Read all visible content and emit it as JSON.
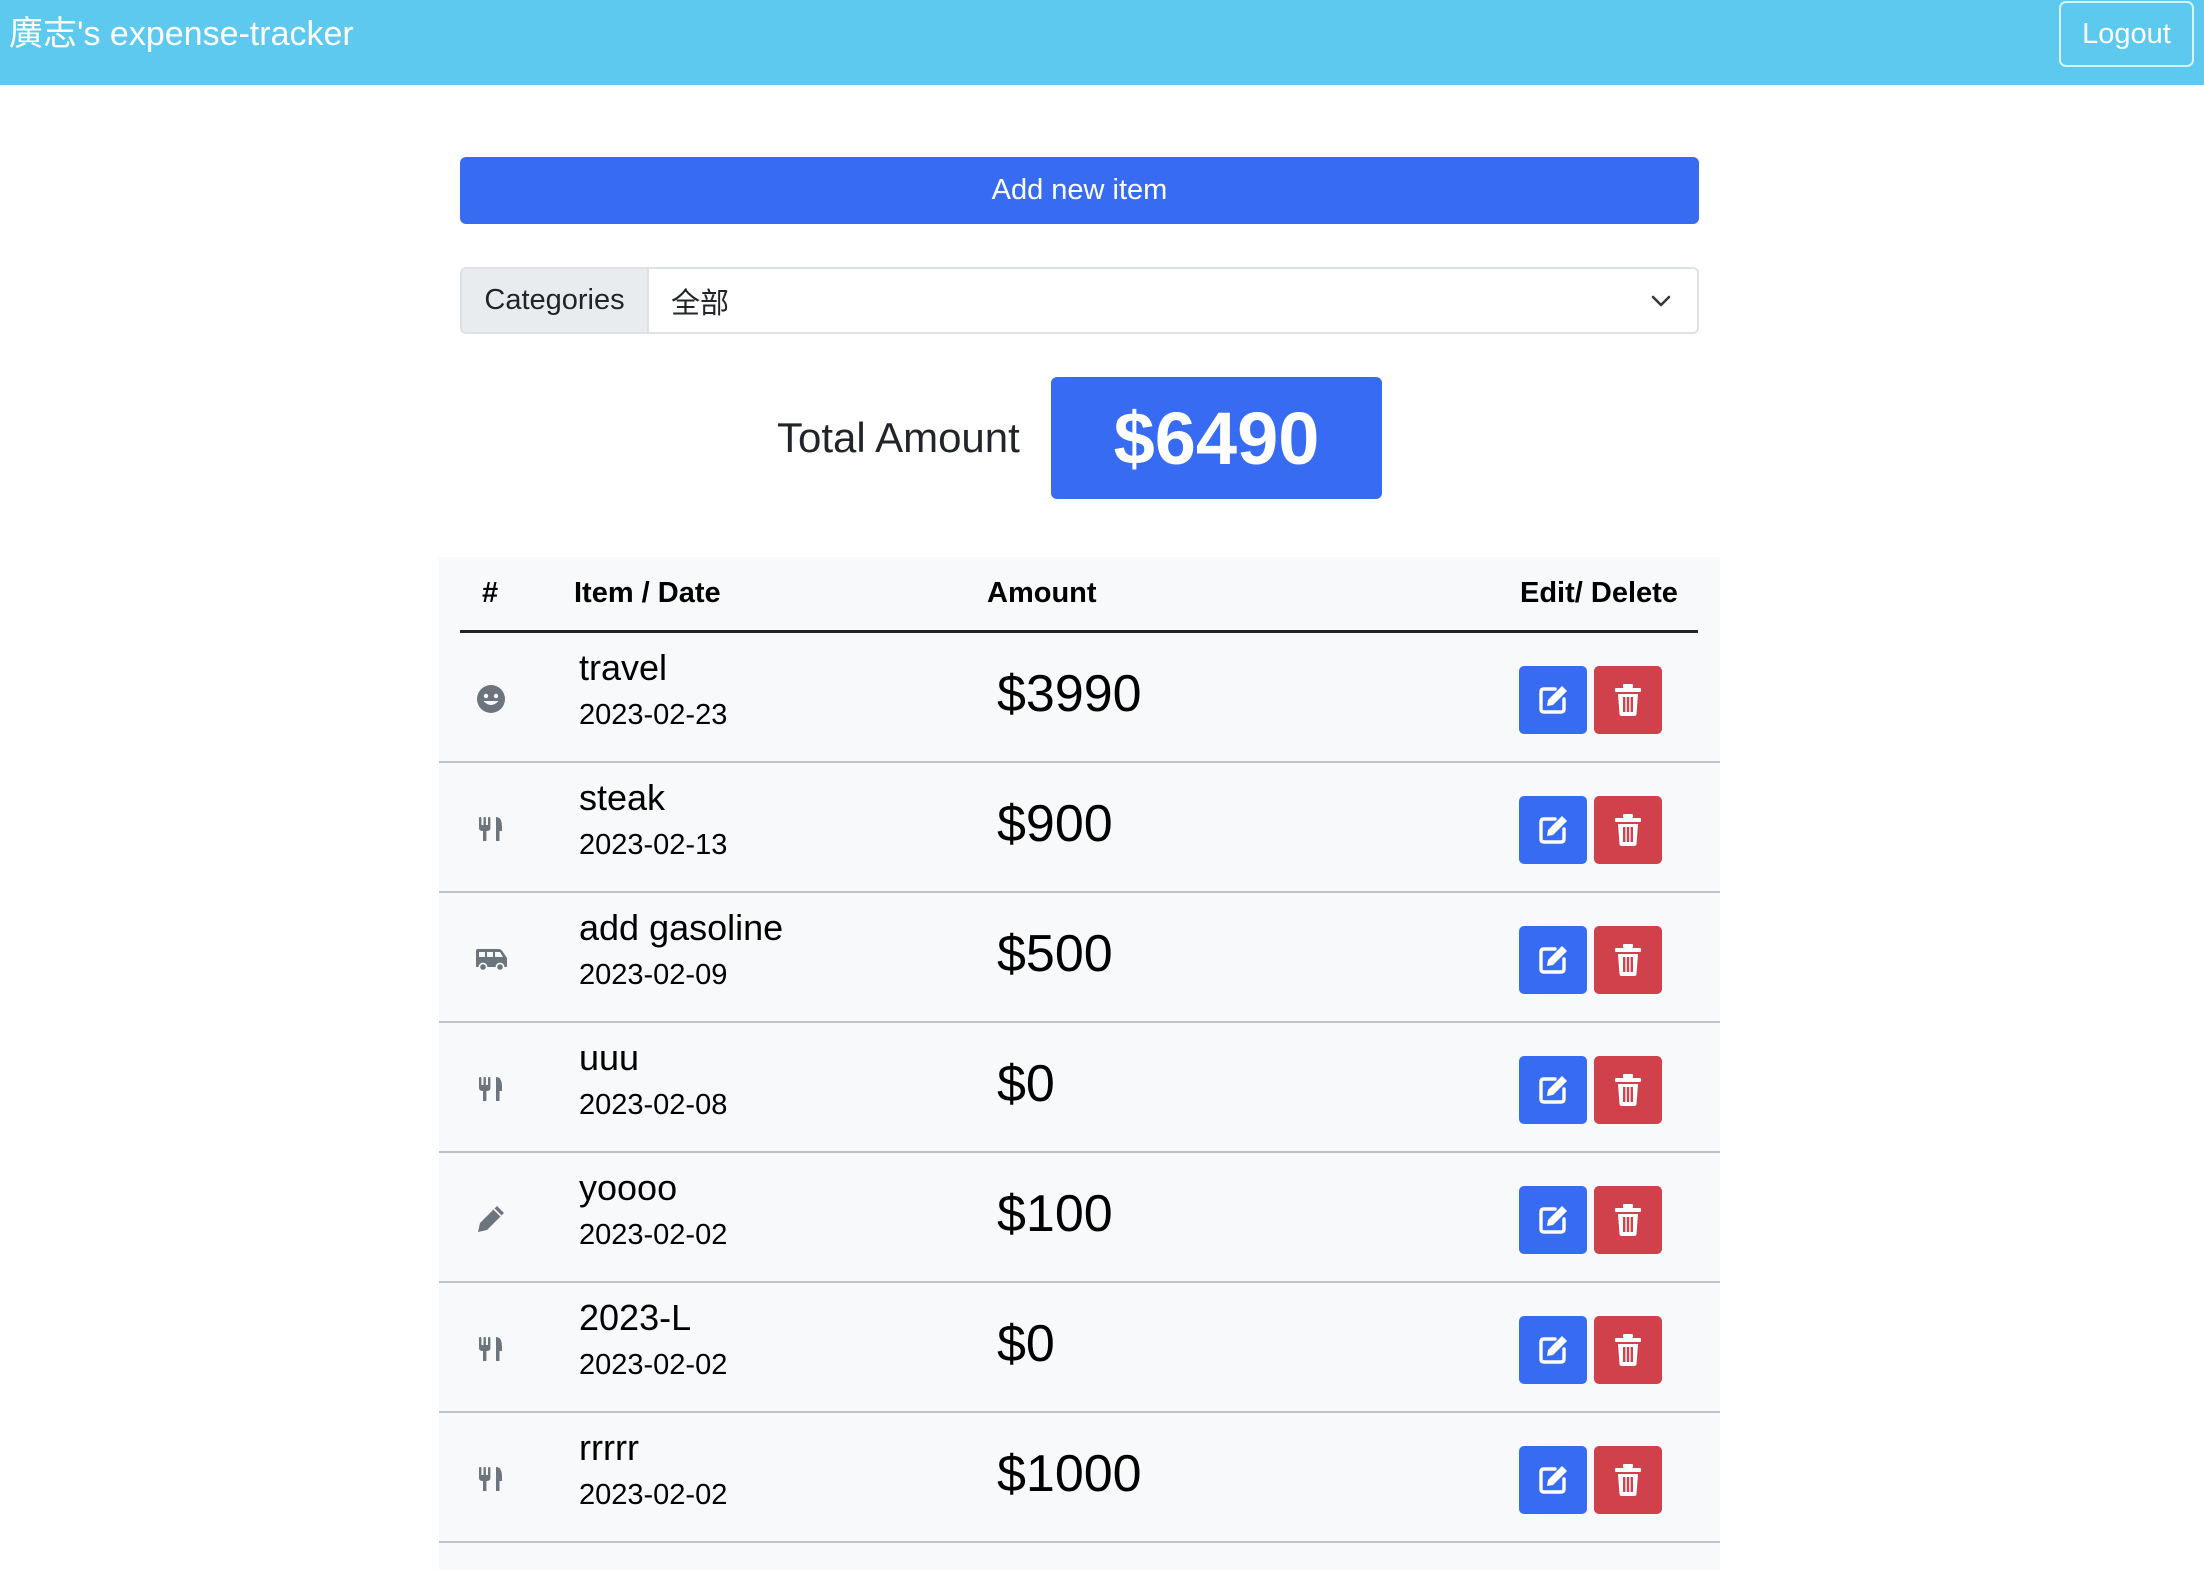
{
  "navbar": {
    "brand": "廣志's expense-tracker",
    "logout_label": "Logout"
  },
  "add_button_label": "Add new item",
  "categories": {
    "label": "Categories",
    "selected": "全部"
  },
  "total": {
    "label": "Total Amount",
    "value": "$6490"
  },
  "table": {
    "headers": {
      "num": "#",
      "item_date": "Item / Date",
      "amount": "Amount",
      "actions": "Edit/ Delete"
    },
    "rows": [
      {
        "icon": "smile-icon",
        "name": "travel",
        "date": "2023-02-23",
        "amount": "$3990"
      },
      {
        "icon": "utensils-icon",
        "name": "steak",
        "date": "2023-02-13",
        "amount": "$900"
      },
      {
        "icon": "van-icon",
        "name": "add gasoline",
        "date": "2023-02-09",
        "amount": "$500"
      },
      {
        "icon": "utensils-icon",
        "name": "uuu",
        "date": "2023-02-08",
        "amount": "$0"
      },
      {
        "icon": "pencil-icon",
        "name": "yoooo",
        "date": "2023-02-02",
        "amount": "$100"
      },
      {
        "icon": "utensils-icon",
        "name": "2023-L",
        "date": "2023-02-02",
        "amount": "$0"
      },
      {
        "icon": "utensils-icon",
        "name": "rrrrr",
        "date": "2023-02-02",
        "amount": "$1000"
      }
    ]
  },
  "colors": {
    "navbar": "#5ec9ee",
    "primary": "#376cf2",
    "danger": "#d1414b",
    "icon_gray": "#6c757d"
  }
}
